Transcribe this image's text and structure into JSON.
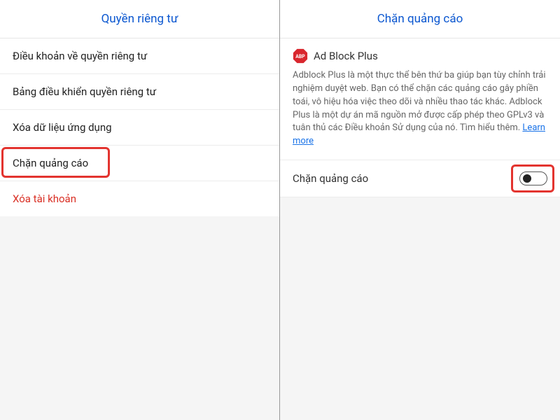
{
  "left": {
    "header_title": "Quyền riêng tư",
    "items": [
      {
        "label": "Điều khoản về quyền riêng tư"
      },
      {
        "label": "Bảng điều khiển quyền riêng tư"
      },
      {
        "label": "Xóa dữ liệu ứng dụng"
      },
      {
        "label": "Chặn quảng cáo"
      },
      {
        "label": "Xóa tài khoản",
        "danger": true
      }
    ]
  },
  "right": {
    "header_title": "Chặn quảng cáo",
    "abp_title": "Ad Block Plus",
    "abp_description": "Adblock Plus là một thực thể bên thứ ba giúp bạn tùy chỉnh trải nghiệm duyệt web. Bạn có thể chặn các quảng cáo gây phiền toái, vô hiệu hóa việc theo dõi và nhiều thao tác khác. Adblock Plus là một dự án mã nguồn mở được cấp phép theo GPLv3 và tuân thủ các Điều khoản Sử dụng của nó. Tìm hiểu thêm. ",
    "learn_more_label": "Learn more",
    "toggle_label": "Chặn quảng cáo"
  }
}
